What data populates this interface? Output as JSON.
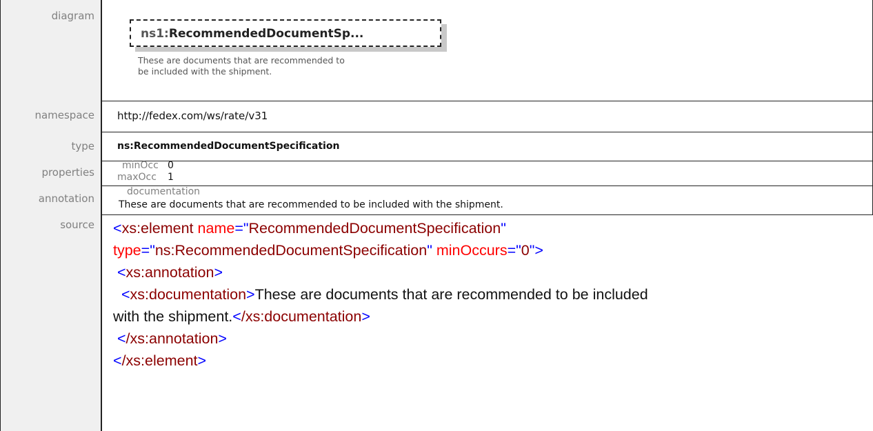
{
  "labels": {
    "diagram": "diagram",
    "namespace": "namespace",
    "type": "type",
    "properties": "properties",
    "annotation": "annotation",
    "source": "source"
  },
  "diagram": {
    "prefix": "ns1:",
    "element_name": "RecommendedDocumentSp...",
    "documentation_line1": "These are documents that are recommended to",
    "documentation_line2": "be included with the shipment."
  },
  "namespace": "http://fedex.com/ws/rate/v31",
  "type": "ns:RecommendedDocumentSpecification",
  "properties": [
    {
      "name": "minOcc",
      "value": "0"
    },
    {
      "name": "maxOcc",
      "value": "1"
    }
  ],
  "annotation": {
    "key": "documentation",
    "text": "These are documents that are recommended to be included with the shipment."
  },
  "source": {
    "line1_tag": "xs:element",
    "attr_name": "name",
    "attr_name_value": "RecommendedDocumentSpecification",
    "attr_type": "type",
    "attr_type_value": "ns:RecommendedDocumentSpecification",
    "attr_minoccurs": "minOccurs",
    "attr_minoccurs_value": "0",
    "annotation_tag": "xs:annotation",
    "documentation_tag": "xs:documentation",
    "documentation_text_a": "These are documents that are recommended to be included",
    "documentation_text_b": "with the shipment.",
    "documentation_close": "/xs:documentation",
    "annotation_close": "/xs:annotation",
    "element_close": "/xs:element"
  }
}
